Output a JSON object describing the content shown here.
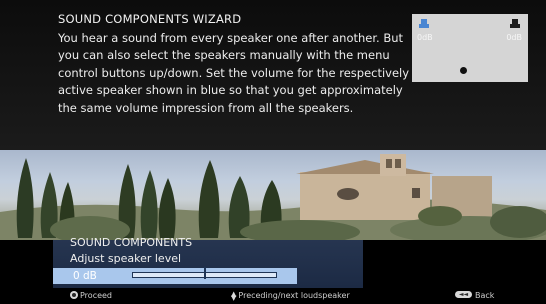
{
  "wizard": {
    "title": "SOUND COMPONENTS WIZARD",
    "text": "You hear a sound from every speaker one after another. But you can also select the speakers manually with the menu control buttons up/down. Set the volume for the respectively active speaker shown in blue so that you get approximately the same volume impression from all the speakers."
  },
  "speaker_diagram": {
    "left_label": "0dB",
    "right_label": "0dB",
    "active_color": "#4a86d2",
    "inactive_color": "#1c1c1c"
  },
  "menu": {
    "title": "SOUND COMPONENTS",
    "subtitle": "Adjust speaker level",
    "level_value": "0 dB",
    "level_fraction": 0.5
  },
  "hints": {
    "proceed": "Proceed",
    "navigate": "Preceding/next loudspeaker",
    "back": "Back",
    "back_button_glyph": "◄◄"
  },
  "colors": {
    "menu_box": "#263550",
    "selected_row": "#a9c7ec"
  }
}
